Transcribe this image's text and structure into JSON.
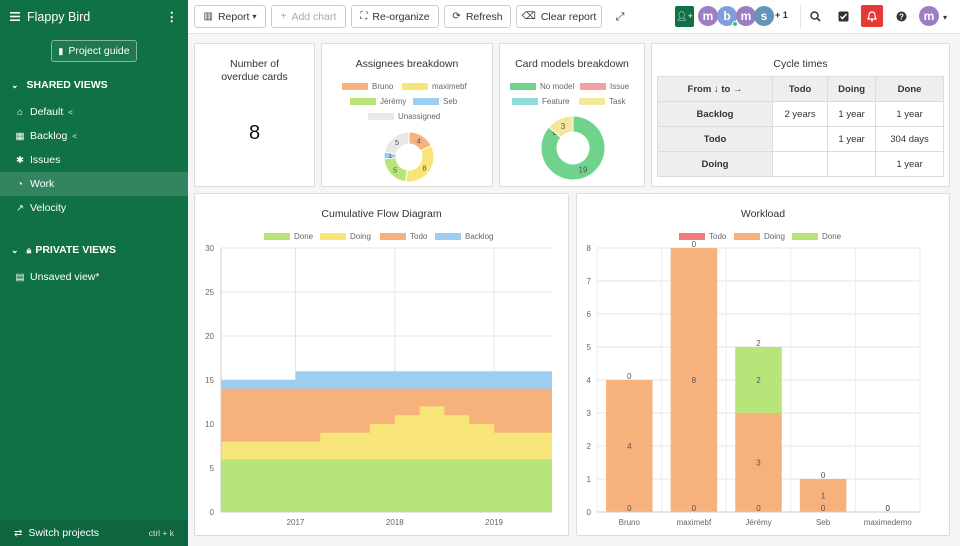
{
  "project": {
    "title": "Flappy Bird",
    "guide_label": "Project guide"
  },
  "sidebar": {
    "shared_label": "SHARED VIEWS",
    "private_label": "PRIVATE VIEWS",
    "shared_items": [
      {
        "label": "Default",
        "icon": "home-icon",
        "shared": true
      },
      {
        "label": "Backlog",
        "icon": "grid-icon",
        "shared": true
      },
      {
        "label": "Issues",
        "icon": "bug-icon",
        "shared": false
      },
      {
        "label": "Work",
        "icon": "dashboard-icon",
        "shared": false,
        "active": true
      },
      {
        "label": "Velocity",
        "icon": "chart-line-icon",
        "shared": false
      }
    ],
    "private_items": [
      {
        "label": "Unsaved view*",
        "icon": "calendar-icon"
      }
    ],
    "footer": {
      "label": "Switch projects",
      "shortcut": "ctrl + k"
    }
  },
  "toolbar": {
    "report_label": "Report",
    "add_chart_label": "Add chart",
    "reorganize_label": "Re-organize",
    "refresh_label": "Refresh",
    "clear_label": "Clear report",
    "members_extra": "+ 1",
    "members": [
      {
        "initial": "m",
        "color": "#9b7fc2",
        "online": false
      },
      {
        "initial": "b",
        "color": "#7f9fd6",
        "online": true
      },
      {
        "initial": "m",
        "color": "#9b7fc2",
        "online": false
      },
      {
        "initial": "s",
        "color": "#6495b8",
        "online": false
      }
    ],
    "user_initial": "m",
    "colors": {
      "brand": "#107046",
      "alert": "#e53935"
    }
  },
  "overdue": {
    "title": "Number of overdue cards",
    "value": "8"
  },
  "assignees": {
    "title": "Assignees breakdown",
    "chart_data": {
      "type": "pie",
      "labels": [
        "Bruno",
        "maximebf",
        "Jérémy",
        "Seb",
        "Unassigned"
      ],
      "colors": [
        "#f7b17d",
        "#f8e579",
        "#b7e57a",
        "#9dcdf1",
        "#e8e8e8"
      ],
      "values": [
        4,
        8,
        5,
        1,
        5
      ]
    }
  },
  "card_models": {
    "title": "Card models breakdown",
    "chart_data": {
      "type": "pie",
      "labels": [
        "No model",
        "Issue",
        "Feature",
        "Task"
      ],
      "colors": [
        "#6fd38b",
        "#f2a0a0",
        "#8fdcdc",
        "#f5e79a"
      ],
      "values": [
        19,
        0,
        0,
        3
      ]
    }
  },
  "cycle_times": {
    "title": "Cycle times",
    "corner": "From ↓ to →",
    "columns": [
      "Todo",
      "Doing",
      "Done"
    ],
    "rows": [
      {
        "name": "Backlog",
        "cells": [
          "2 years",
          "1 year",
          "1 year"
        ]
      },
      {
        "name": "Todo",
        "cells": [
          "",
          "1 year",
          "304 days"
        ]
      },
      {
        "name": "Doing",
        "cells": [
          "",
          "",
          "1 year"
        ]
      }
    ]
  },
  "cfd": {
    "title": "Cumulative Flow Diagram",
    "chart_data": {
      "type": "area",
      "series": [
        {
          "name": "Done",
          "color": "#b7e57a"
        },
        {
          "name": "Doing",
          "color": "#f8e579"
        },
        {
          "name": "Todo",
          "color": "#f7b17d"
        },
        {
          "name": "Backlog",
          "color": "#9dcdf1"
        }
      ],
      "x": [
        "2016-04",
        "2016-10",
        "2016-12",
        "2017-01",
        "2017-04",
        "2017-10",
        "2018-01",
        "2018-04",
        "2018-07",
        "2018-10",
        "2019-01",
        "2019-04",
        "2019-07",
        "2019-08"
      ],
      "cumulative": {
        "Done": [
          6,
          6,
          6,
          6,
          6,
          6,
          6,
          6,
          6,
          6,
          6,
          6,
          6,
          3
        ],
        "Doing": [
          8,
          8,
          8,
          8,
          9,
          10,
          11,
          12,
          11,
          10,
          9,
          9,
          9,
          6
        ],
        "Todo": [
          14,
          14,
          14,
          14,
          14,
          14,
          14,
          14,
          14,
          14,
          14,
          14,
          14,
          12
        ],
        "Backlog": [
          15,
          15,
          15,
          16,
          16,
          16,
          16,
          16,
          16,
          16,
          16,
          16,
          16,
          12
        ]
      },
      "x_ticks": [
        "2017",
        "2018",
        "2019"
      ],
      "y_ticks": [
        0,
        5,
        10,
        15,
        20,
        25,
        30
      ],
      "ylim": [
        0,
        30
      ]
    }
  },
  "workload": {
    "title": "Workload",
    "chart_data": {
      "type": "bar",
      "categories": [
        "Bruno",
        "maximebf",
        "Jérémy",
        "Seb",
        "maximedemo"
      ],
      "series": [
        {
          "name": "Todo",
          "color": "#f07c7c",
          "values": [
            0,
            0,
            0,
            0,
            0
          ]
        },
        {
          "name": "Doing",
          "color": "#f7b17d",
          "values": [
            4,
            8,
            3,
            1,
            0
          ]
        },
        {
          "name": "Done",
          "color": "#b7e57a",
          "values": [
            0,
            0,
            2,
            0,
            0
          ]
        }
      ],
      "y_ticks": [
        0,
        1,
        2,
        3,
        4,
        5,
        6,
        7,
        8
      ],
      "ylim": [
        0,
        8
      ]
    }
  }
}
